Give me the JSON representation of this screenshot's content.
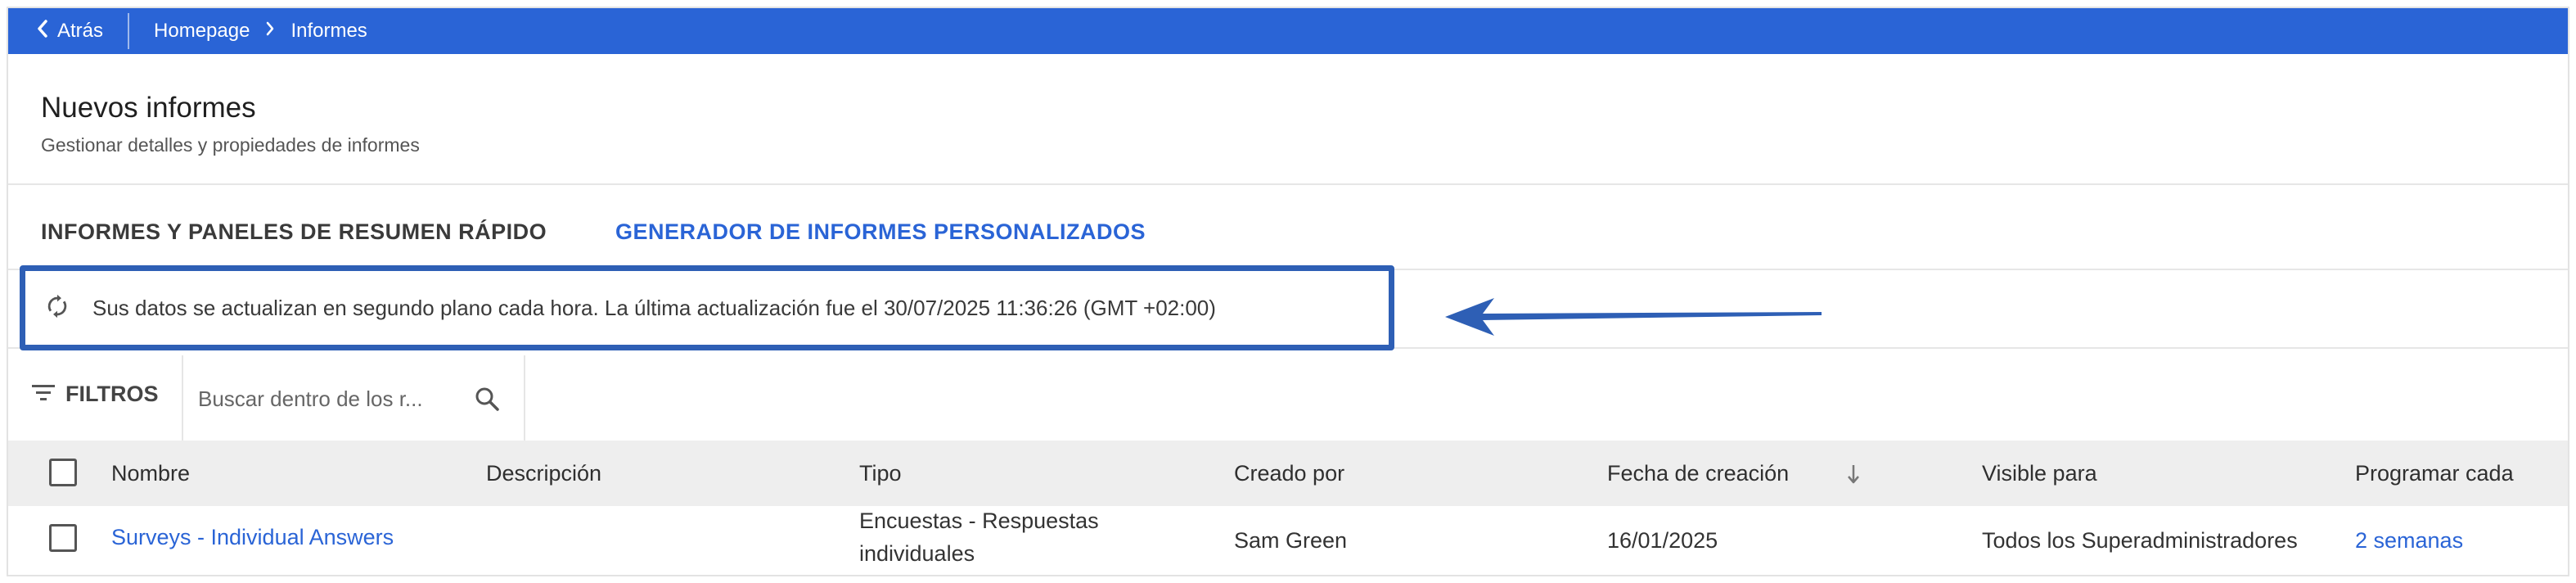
{
  "nav": {
    "back_label": "Atrás",
    "breadcrumbs": [
      "Homepage",
      "Informes"
    ]
  },
  "header": {
    "title": "Nuevos informes",
    "subtitle": "Gestionar detalles y propiedades de informes"
  },
  "tabs": [
    {
      "label": "INFORMES Y PANELES DE RESUMEN RÁPIDO",
      "active": false
    },
    {
      "label": "GENERADOR DE INFORMES PERSONALIZADOS",
      "active": true
    }
  ],
  "info": {
    "text": "Sus datos se actualizan en segundo plano cada hora. La última actualización fue el 30/07/2025 11:36:26 (GMT +02:00)"
  },
  "toolbar": {
    "filters_label": "FILTROS",
    "search_placeholder": "Buscar dentro de los r..."
  },
  "table": {
    "columns": [
      "Nombre",
      "Descripción",
      "Tipo",
      "Creado por",
      "Fecha de creación",
      "Visible para",
      "Programar cada"
    ],
    "sort_column": "Fecha de creación",
    "rows": [
      {
        "name": "Surveys - Individual Answers",
        "description": "",
        "type_line1": "Encuestas - Respuestas",
        "type_line2": "individuales",
        "created_by": "Sam Green",
        "created_date": "16/01/2025",
        "visible_to": "Todos los Superadministradores",
        "schedule": "2 semanas"
      }
    ]
  },
  "colors": {
    "accent": "#2a64d6",
    "highlight_box": "#2e5fb5",
    "table_header_bg": "#eeeeee"
  },
  "icons": [
    "chevron-left-icon",
    "chevron-right-icon",
    "refresh-icon",
    "filter-icon",
    "search-icon",
    "sort-down-icon"
  ]
}
